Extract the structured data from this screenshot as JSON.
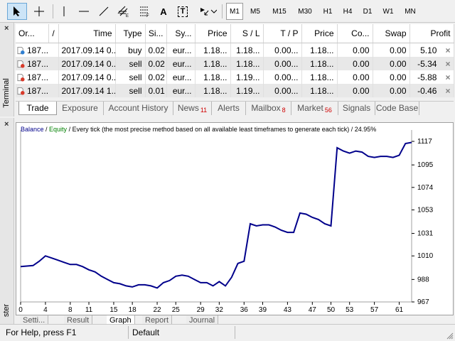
{
  "toolbar": {
    "timeframes": [
      "M1",
      "M5",
      "M15",
      "M30",
      "H1",
      "H4",
      "D1",
      "W1",
      "MN"
    ],
    "active_timeframe": "M1",
    "tools": [
      "cursor-icon",
      "crosshair-icon",
      "vertical-line-icon",
      "horizontal-line-icon",
      "trendline-icon",
      "channel-icon",
      "fibonacci-icon",
      "text-icon",
      "text-label-icon",
      "arrows-icon"
    ],
    "text_tool_label": "A",
    "text_label_tool_label": "T"
  },
  "terminal": {
    "side_label": "Terminal",
    "close_glyph": "×",
    "columns": [
      "Or...",
      "/",
      "Time",
      "Type",
      "Si...",
      "Sy...",
      "Price",
      "S / L",
      "T / P",
      "Price",
      "Co...",
      "Swap",
      "Profit"
    ],
    "rows": [
      {
        "order": "187...",
        "time": "2017.09.14 0...",
        "type": "buy",
        "size": "0.02",
        "symbol": "eur...",
        "price": "1.18...",
        "sl": "1.18...",
        "tp": "0.00...",
        "cur_price": "1.18...",
        "commission": "0.00",
        "swap": "0.00",
        "profit": "5.10",
        "icon": "buy"
      },
      {
        "order": "187...",
        "time": "2017.09.14 0...",
        "type": "sell",
        "size": "0.02",
        "symbol": "eur...",
        "price": "1.18...",
        "sl": "1.18...",
        "tp": "0.00...",
        "cur_price": "1.18...",
        "commission": "0.00",
        "swap": "0.00",
        "profit": "-5.34",
        "icon": "sell"
      },
      {
        "order": "187...",
        "time": "2017.09.14 0...",
        "type": "sell",
        "size": "0.02",
        "symbol": "eur...",
        "price": "1.18...",
        "sl": "1.19...",
        "tp": "0.00...",
        "cur_price": "1.18...",
        "commission": "0.00",
        "swap": "0.00",
        "profit": "-5.88",
        "icon": "sell"
      },
      {
        "order": "187...",
        "time": "2017.09.14 1...",
        "type": "sell",
        "size": "0.01",
        "symbol": "eur...",
        "price": "1.18...",
        "sl": "1.19...",
        "tp": "0.00...",
        "cur_price": "1.18...",
        "commission": "0.00",
        "swap": "0.00",
        "profit": "-0.46",
        "icon": "sell"
      }
    ],
    "row_close_glyph": "×",
    "tabs": [
      {
        "label": "Trade",
        "badge": "",
        "active": true
      },
      {
        "label": "Exposure",
        "badge": "",
        "active": false
      },
      {
        "label": "Account History",
        "badge": "",
        "active": false
      },
      {
        "label": "News",
        "badge": "11",
        "active": false
      },
      {
        "label": "Alerts",
        "badge": "",
        "active": false
      },
      {
        "label": "Mailbox",
        "badge": "8",
        "active": false
      },
      {
        "label": "Market",
        "badge": "56",
        "active": false
      },
      {
        "label": "Signals",
        "badge": "",
        "active": false
      },
      {
        "label": "Code Base",
        "badge": "",
        "active": false
      }
    ]
  },
  "tester": {
    "side_label": "ster",
    "close_glyph": "×",
    "header": {
      "balance": "Balance",
      "slash1": " / ",
      "equity": "Equity",
      "slash2": " / ",
      "mode": "Every tick (the most precise method based on all available least timeframes to generate each tick)",
      "slash3": " / ",
      "progress": "24.95%"
    },
    "bottom_tabs": [
      "Setti...",
      "Result",
      "Graph",
      "Report",
      "Journal"
    ],
    "active_bottom_tab": "Graph"
  },
  "colors": {
    "balance_line": "#00008b",
    "equity_label": "#008000",
    "badge": "#d00000",
    "buy_icon": "#2f7fd1",
    "sell_icon": "#d83a2a"
  },
  "chart_data": {
    "type": "line",
    "title": "",
    "xlabel": "",
    "ylabel": "",
    "xlim": [
      0,
      63
    ],
    "ylim": [
      967,
      1117
    ],
    "x_ticks": [
      0,
      4,
      8,
      11,
      15,
      18,
      22,
      25,
      29,
      32,
      36,
      39,
      43,
      47,
      50,
      53,
      57,
      61
    ],
    "y_ticks": [
      967,
      988,
      1010,
      1031,
      1053,
      1074,
      1095,
      1117
    ],
    "series": [
      {
        "name": "Balance",
        "x": [
          0,
          2,
          3,
          4,
          5,
          6,
          7,
          8,
          9,
          10,
          11,
          12,
          13,
          14,
          15,
          16,
          17,
          18,
          19,
          20,
          21,
          22,
          23,
          24,
          25,
          26,
          27,
          28,
          29,
          30,
          31,
          32,
          33,
          34,
          35,
          36,
          37,
          38,
          39,
          40,
          41,
          42,
          43,
          44,
          45,
          46,
          47,
          48,
          49,
          50,
          51,
          52,
          53,
          54,
          55,
          56,
          57,
          58,
          59,
          60,
          61,
          62,
          63
        ],
        "y": [
          1000,
          1001,
          1005,
          1010,
          1008,
          1006,
          1004,
          1002,
          1002,
          1000,
          997,
          995,
          991,
          988,
          985,
          984,
          982,
          981,
          983,
          983,
          982,
          980,
          985,
          987,
          991,
          992,
          991,
          988,
          985,
          985,
          982,
          986,
          982,
          990,
          1003,
          1005,
          1040,
          1038,
          1039,
          1039,
          1037,
          1034,
          1032,
          1032,
          1050,
          1049,
          1046,
          1044,
          1040,
          1038,
          1111,
          1108,
          1106,
          1108,
          1107,
          1103,
          1102,
          1103,
          1103,
          1102,
          1104,
          1115,
          1116
        ]
      }
    ]
  },
  "status": {
    "help": "For Help, press F1",
    "profile": "Default"
  }
}
